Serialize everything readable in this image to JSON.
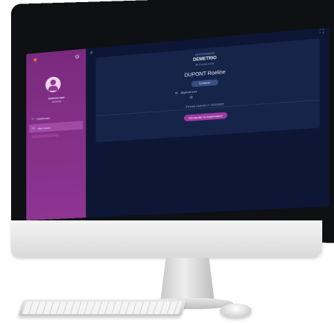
{
  "sidebar": {
    "user_name": "Dietrich Hair",
    "user_subtitle": "candidat",
    "nav": [
      {
        "label": "Dashboard",
        "icon": "home-icon"
      },
      {
        "label": "Mes cours",
        "icon": "book-icon"
      }
    ]
  },
  "profile": {
    "label": "GESTIONNAIRE",
    "name_primary": "DEMETRIO",
    "name_secondary_sub": "88 Course route",
    "full_name": "DUPONT Roeline",
    "contact_button": "Contacter",
    "email": "@gmail.com",
    "license": "Permis Licence n° 11013325",
    "action_button": "Demander la suppression"
  },
  "colors": {
    "sidebar": "#8e3592",
    "screen_bg": "#0d1635",
    "card_bg": "#16244a",
    "action": "#9c3aa1"
  }
}
